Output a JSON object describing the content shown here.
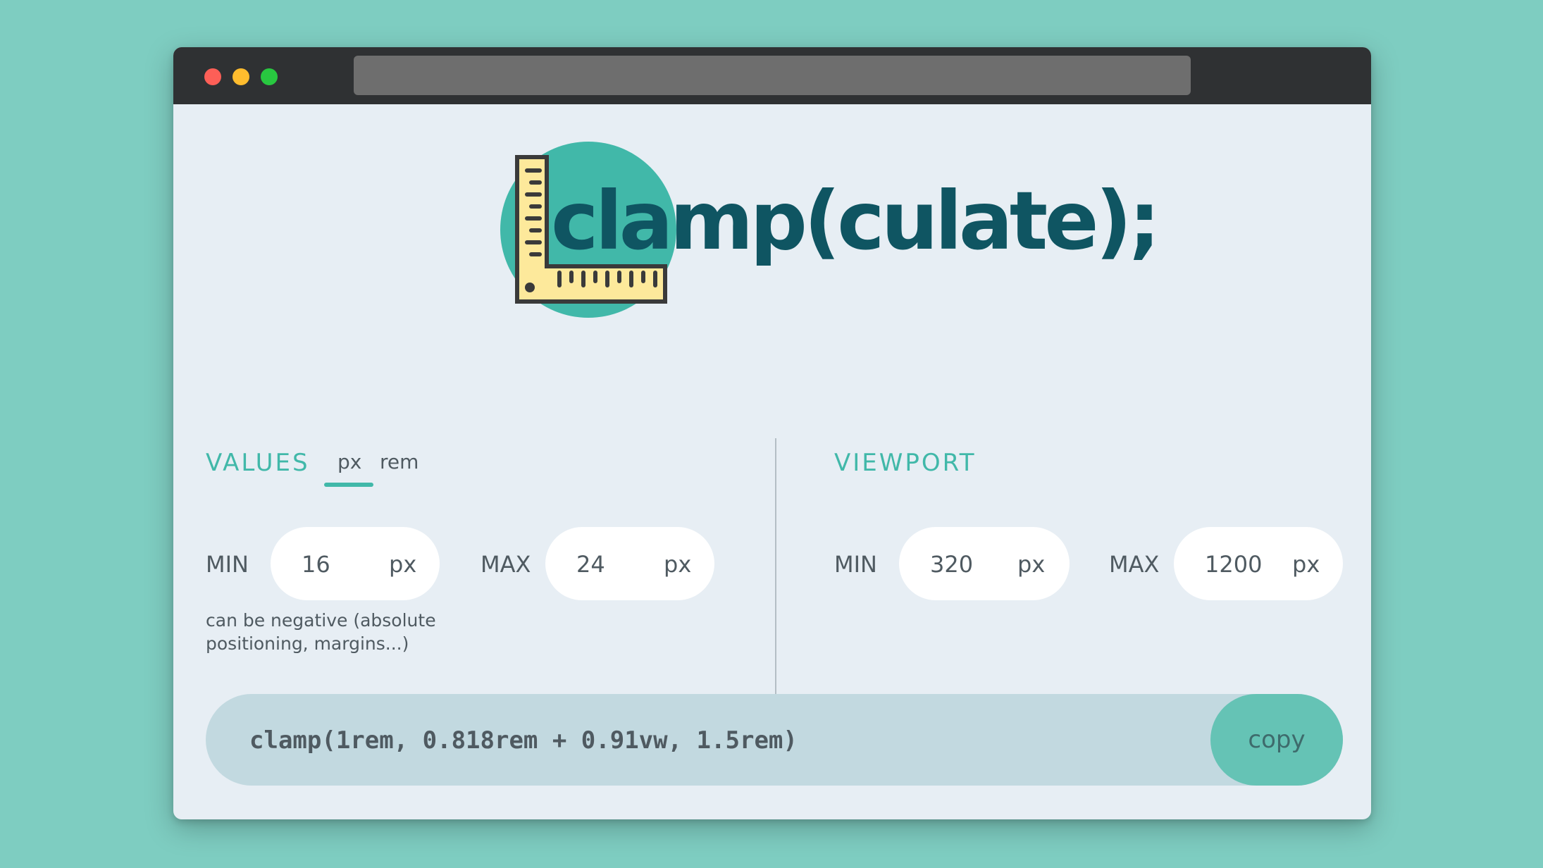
{
  "app": {
    "title": "clamp(culate);"
  },
  "values_section": {
    "heading": "VALUES",
    "units": [
      "px",
      "rem"
    ],
    "selected_unit": "px",
    "min_label": "MIN",
    "min_value": "16",
    "min_unit": "px",
    "max_label": "MAX",
    "max_value": "24",
    "max_unit": "px",
    "note": "can be negative (absolute positioning, margins...)"
  },
  "viewport_section": {
    "heading": "VIEWPORT",
    "min_label": "MIN",
    "min_value": "320",
    "min_unit": "px",
    "max_label": "MAX",
    "max_value": "1200",
    "max_unit": "px"
  },
  "output": {
    "code": "clamp(1rem, 0.818rem + 0.91vw, 1.5rem)",
    "copy_label": "copy"
  },
  "colors": {
    "background": "#7ecdc1",
    "accent": "#41b8a9",
    "title": "#0f5562",
    "window": "#e7eef4",
    "titlebar": "#2f3133"
  }
}
